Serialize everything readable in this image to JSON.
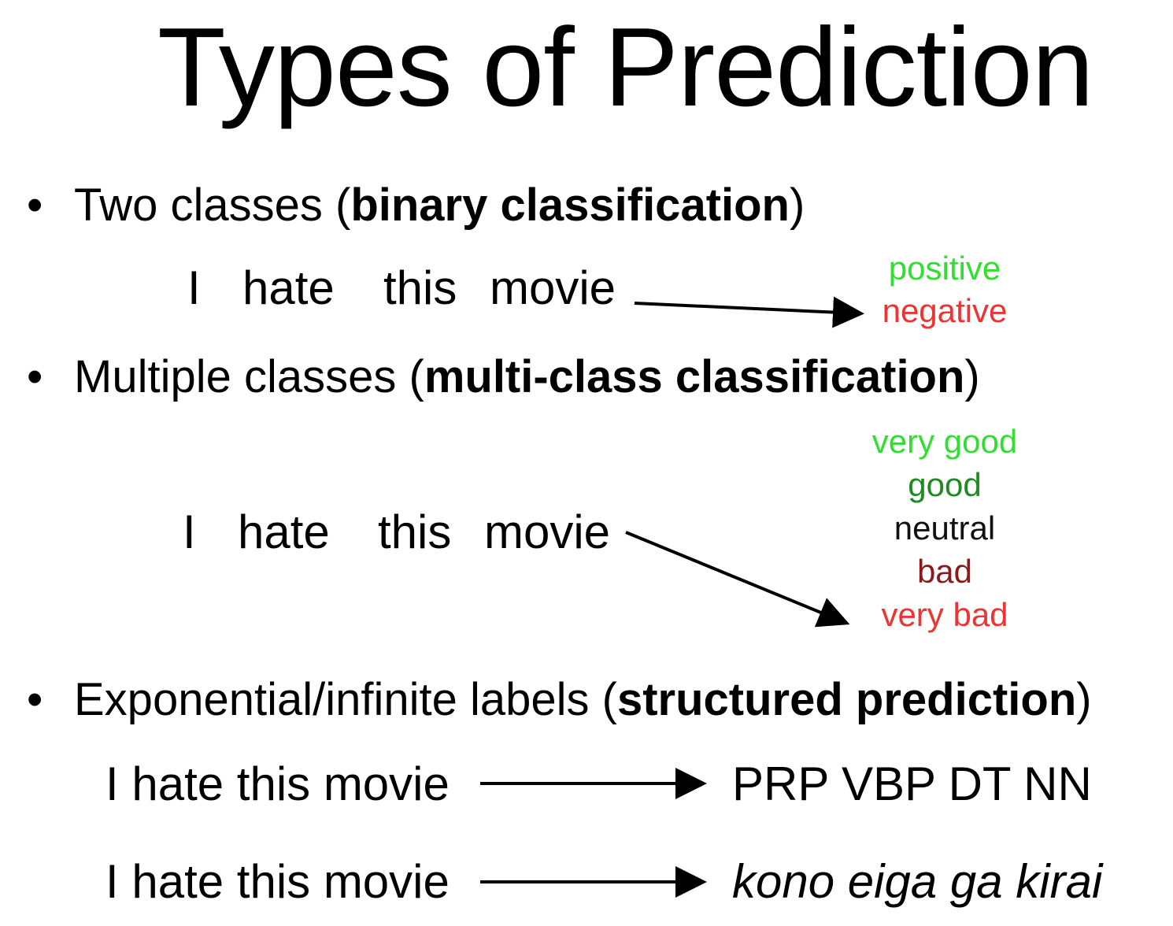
{
  "title": "Types of Prediction",
  "bullets": [
    {
      "prefix": "Two classes (",
      "bold": "binary classification",
      "suffix": ")"
    },
    {
      "prefix": "Multiple classes (",
      "bold": "multi-class classification",
      "suffix": ")"
    },
    {
      "prefix": "Exponential/infinite labels (",
      "bold": "structured prediction",
      "suffix": ")"
    }
  ],
  "binary_example": {
    "words": [
      "I",
      "hate",
      "this",
      "movie"
    ],
    "labels": [
      {
        "text": "positive",
        "color": "#33dd33"
      },
      {
        "text": "negative",
        "color": "#ee3333"
      }
    ]
  },
  "multiclass_example": {
    "words": [
      "I",
      "hate",
      "this",
      "movie"
    ],
    "labels": [
      {
        "text": "very good",
        "color": "#33dd33"
      },
      {
        "text": "good",
        "color": "#1f8a1f"
      },
      {
        "text": "neutral",
        "color": "#111111"
      },
      {
        "text": "bad",
        "color": "#8b1a1a"
      },
      {
        "text": "very bad",
        "color": "#ee3333"
      }
    ]
  },
  "structured_examples": [
    {
      "input": "I hate this movie",
      "output": "PRP VBP DT NN"
    },
    {
      "input": "I hate this movie",
      "output": "kono eiga ga kirai"
    }
  ]
}
